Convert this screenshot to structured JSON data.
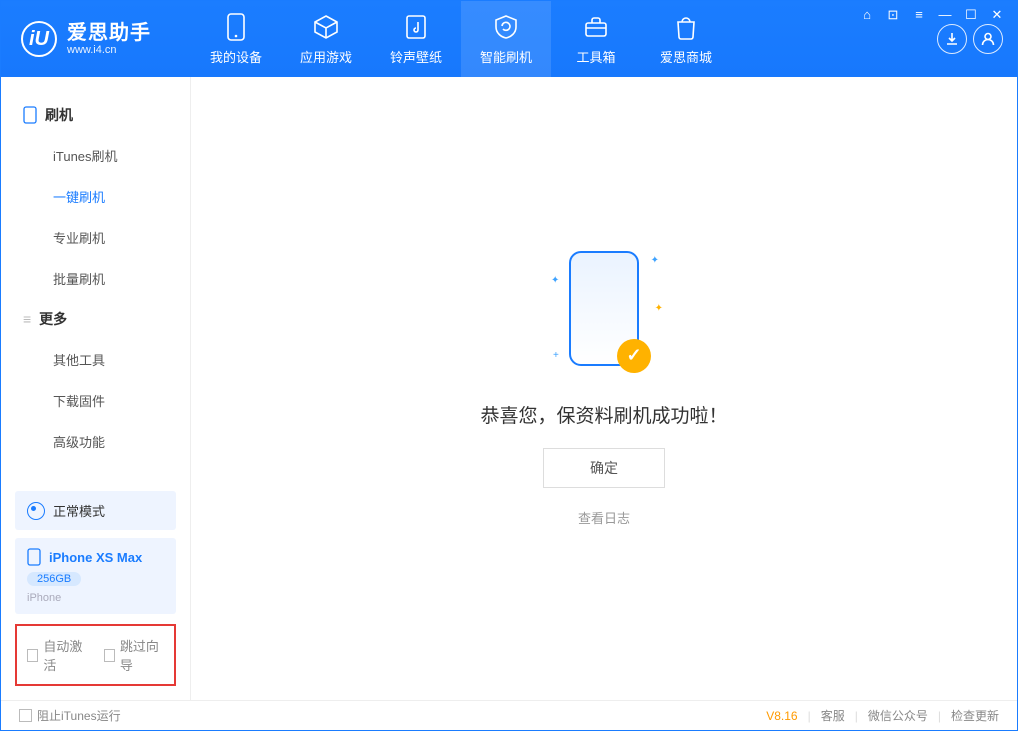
{
  "app": {
    "name": "爱思助手",
    "url": "www.i4.cn"
  },
  "nav": {
    "tabs": [
      {
        "label": "我的设备"
      },
      {
        "label": "应用游戏"
      },
      {
        "label": "铃声壁纸"
      },
      {
        "label": "智能刷机"
      },
      {
        "label": "工具箱"
      },
      {
        "label": "爱思商城"
      }
    ],
    "active_index": 3
  },
  "sidebar": {
    "group1_title": "刷机",
    "group1_items": [
      {
        "label": "iTunes刷机"
      },
      {
        "label": "一键刷机"
      },
      {
        "label": "专业刷机"
      },
      {
        "label": "批量刷机"
      }
    ],
    "group1_active_index": 1,
    "group2_title": "更多",
    "group2_items": [
      {
        "label": "其他工具"
      },
      {
        "label": "下载固件"
      },
      {
        "label": "高级功能"
      }
    ],
    "mode_label": "正常模式",
    "device": {
      "name": "iPhone XS Max",
      "capacity": "256GB",
      "type": "iPhone"
    },
    "options": {
      "auto_activate": "自动激活",
      "skip_guide": "跳过向导"
    }
  },
  "content": {
    "success_text": "恭喜您，保资料刷机成功啦！",
    "ok_label": "确定",
    "log_link": "查看日志"
  },
  "statusbar": {
    "block_itunes": "阻止iTunes运行",
    "version": "V8.16",
    "support": "客服",
    "wechat": "微信公众号",
    "update": "检查更新"
  }
}
